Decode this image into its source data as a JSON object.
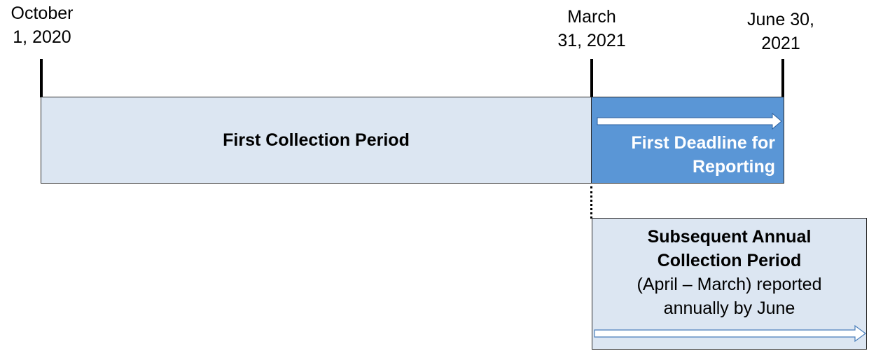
{
  "dates": {
    "start": {
      "line1": "October",
      "line2": "1, 2020"
    },
    "mid": {
      "line1": "March",
      "line2": "31, 2021"
    },
    "end": {
      "line1": "June 30,",
      "line2": "2021"
    }
  },
  "first_period": {
    "label": "First Collection Period"
  },
  "deadline": {
    "line1": "First Deadline for",
    "line2": "Reporting"
  },
  "subsequent": {
    "title_line1": "Subsequent Annual",
    "title_line2": "Collection Period",
    "desc_line1": "(April – March) reported",
    "desc_line2": "annually by June"
  },
  "colors": {
    "light_fill": "#dce6f2",
    "deadline_fill": "#5a96d6",
    "outline": "#2b2b2b"
  },
  "icons": {
    "deadline_arrow": "right-arrow-icon",
    "subsequent_arrow": "right-arrow-icon"
  }
}
